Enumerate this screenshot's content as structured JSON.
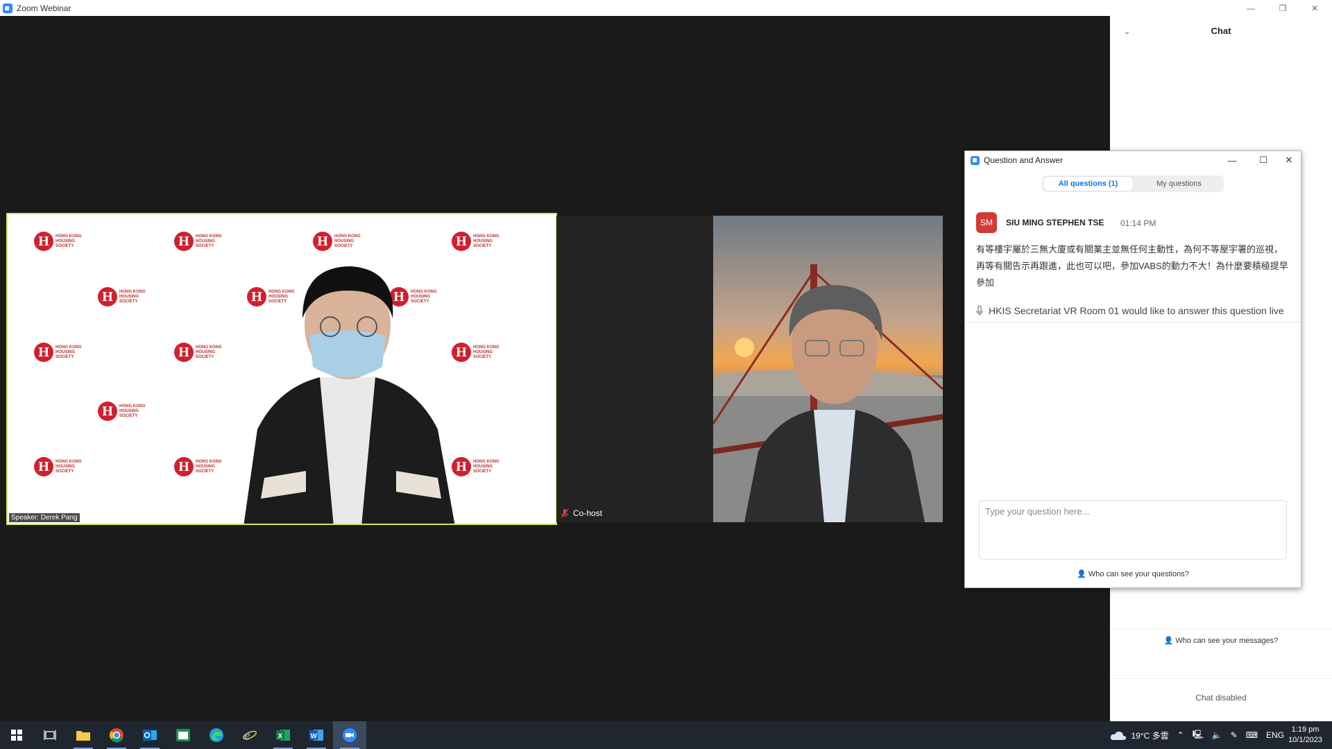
{
  "window": {
    "title": "Zoom Webinar",
    "minimize": "—",
    "restore": "❐",
    "close": "✕"
  },
  "video": {
    "speaker_name": "Speaker: Derek Pang",
    "cohost_label": "Co-host"
  },
  "chat": {
    "title": "Chat",
    "who_can_see": "Who can see your messages?",
    "disabled": "Chat disabled"
  },
  "qa": {
    "title": "Question and Answer",
    "tabs": [
      {
        "label": "All questions (1)",
        "active": true
      },
      {
        "label": "My questions",
        "active": false
      }
    ],
    "question": {
      "avatar": "SM",
      "name": "SIU MING STEPHEN TSE",
      "time": "01:14 PM",
      "text": "有等樓宇屬於三無大廈或有關業主並無任何主動性，為何不等屋宇署的巡視，再等有關告示再跟進，此也可以吧，參加VABS的動力不大！為什麼要積極提早參加",
      "live_answer": "HKIS Secretariat VR Room 01 would like to answer this question live"
    },
    "input_placeholder": "Type your question here...",
    "who_can_see": "Who can see your questions?"
  },
  "taskbar": {
    "weather": "19°C 多雲",
    "language": "ENG",
    "time": "1:19 pm",
    "date": "10/1/2023"
  },
  "colors": {
    "zoom_blue": "#2d8cff",
    "active_tab": "#0e72ed",
    "avatar": "#d13b34",
    "speaker_border": "#d6e85b"
  }
}
